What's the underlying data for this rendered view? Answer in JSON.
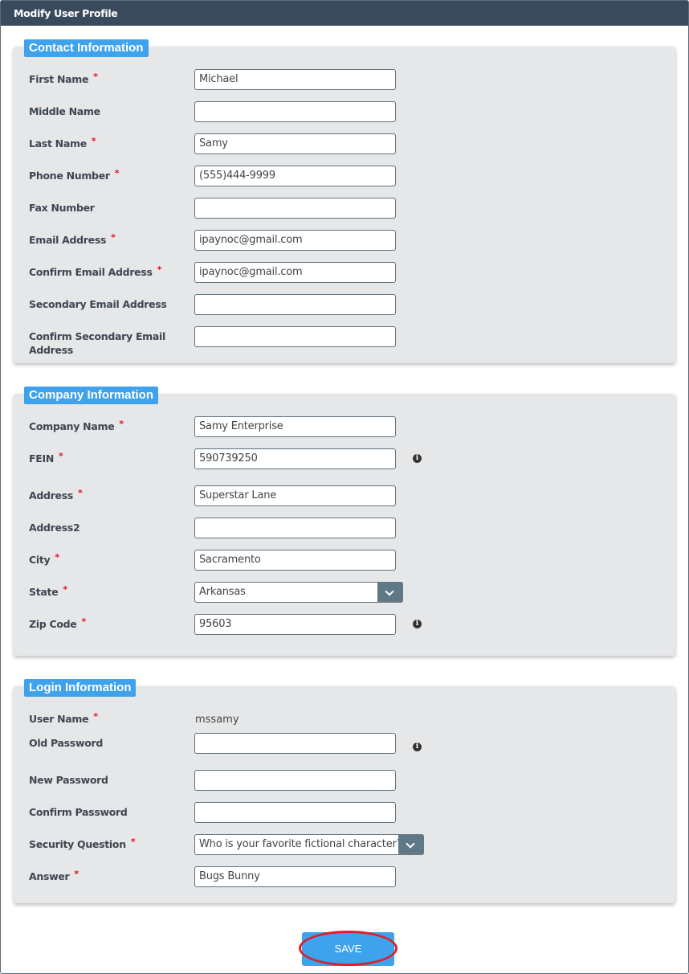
{
  "window": {
    "title": "Modify User Profile"
  },
  "accent": "#3fa2ec",
  "sections": {
    "contact": {
      "title": "Contact Information",
      "fields": [
        {
          "label": "First Name",
          "required": true,
          "value": "Michael"
        },
        {
          "label": "Middle Name",
          "required": false,
          "value": ""
        },
        {
          "label": "Last Name",
          "required": true,
          "value": "Samy"
        },
        {
          "label": "Phone Number",
          "required": true,
          "value": "(555)444-9999"
        },
        {
          "label": "Fax Number",
          "required": false,
          "value": ""
        },
        {
          "label": "Email Address",
          "required": true,
          "value": "ipaynoc@gmail.com"
        },
        {
          "label": "Confirm Email Address",
          "required": true,
          "value": "ipaynoc@gmail.com"
        },
        {
          "label": "Secondary Email Address",
          "required": false,
          "value": ""
        },
        {
          "label": "Confirm Secondary Email Address",
          "required": false,
          "value": ""
        }
      ]
    },
    "company": {
      "title": "Company Information",
      "fields": [
        {
          "label": "Company Name",
          "required": true,
          "value": "Samy Enterprise"
        },
        {
          "label": "FEIN",
          "required": true,
          "value": "590739250",
          "info": true
        },
        {
          "label": "Address",
          "required": true,
          "value": "Superstar Lane"
        },
        {
          "label": "Address2",
          "required": false,
          "value": ""
        },
        {
          "label": "City",
          "required": true,
          "value": "Sacramento"
        },
        {
          "label": "State",
          "required": true,
          "value": "Arkansas",
          "type": "select"
        },
        {
          "label": "Zip Code",
          "required": true,
          "value": "95603",
          "info": true
        }
      ]
    },
    "login": {
      "title": "Login Information",
      "fields": [
        {
          "label": "User Name",
          "required": true,
          "value": "mssamy",
          "type": "static"
        },
        {
          "label": "Old Password",
          "required": false,
          "value": "",
          "info": true
        },
        {
          "label": "New Password",
          "required": false,
          "value": ""
        },
        {
          "label": "Confirm Password",
          "required": false,
          "value": ""
        },
        {
          "label": "Security Question",
          "required": true,
          "value": "Who is your favorite fictional character?",
          "type": "select"
        },
        {
          "label": "Answer",
          "required": true,
          "value": "Bugs Bunny"
        }
      ]
    }
  },
  "required_marker": "*",
  "info_glyph": "i",
  "save_label": "SAVE"
}
